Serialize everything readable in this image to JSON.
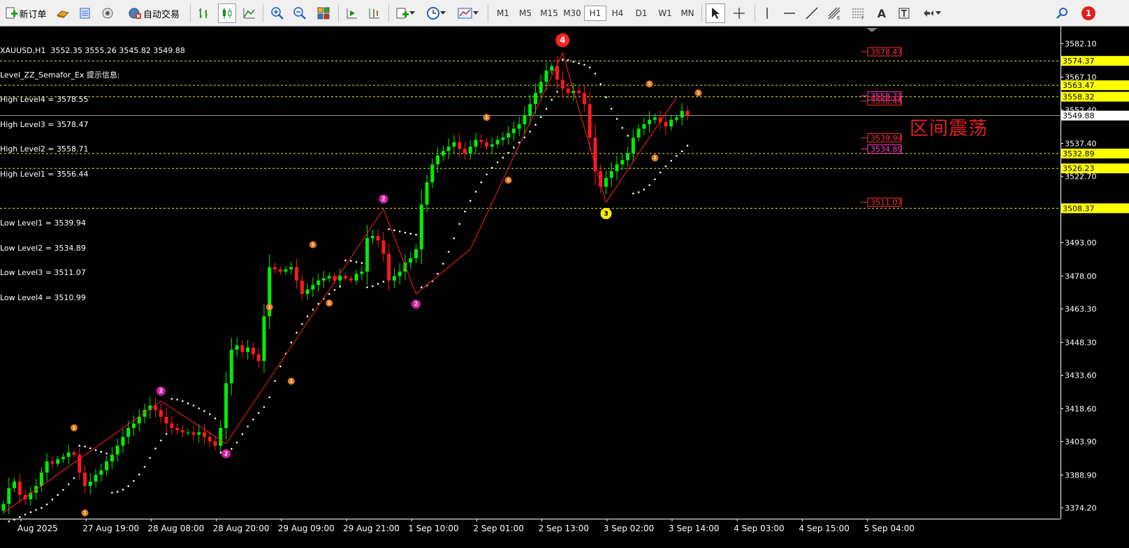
{
  "toolbar": {
    "new_order_label": "新订单",
    "auto_trade_label": "自动交易",
    "timeframes": [
      "M1",
      "M5",
      "M15",
      "M30",
      "H1",
      "H4",
      "D1",
      "W1",
      "MN"
    ],
    "active_timeframe": "H1",
    "text_tool_label": "A",
    "notification_count": "1"
  },
  "info_panel": {
    "header": "XAUUSD,H1  3552.35 3555.26 3545.82 3549.88",
    "indicator": "Level_ZZ_Semafor_Ex 提示信息:",
    "lines": [
      "High Level4 = 3578.55",
      "High Level3 = 3578.47",
      "High Level2 = 3558.71",
      "High Level1 = 3556.44",
      "",
      "Low Level1 = 3539.94",
      "Low Level2 = 3534.89",
      "Low Level3 = 3511.07",
      "Low Level4 = 3510.99"
    ]
  },
  "annotation": "区间震荡",
  "colors": {
    "bull": "#00ee00",
    "bear": "#ff1a1a",
    "zigzag": "#ff2020",
    "sar": "#ffffff",
    "level_line": "#e8e820",
    "label_bg": "#ffff00",
    "semafor1": "#e07a1a",
    "semafor2": "#d020a0",
    "semafor3": "#ffee00",
    "semafor4": "#ff2020",
    "accent_text": "#e02020"
  },
  "chart_data": {
    "type": "candlestick",
    "symbol": "XAUUSD",
    "timeframe": "H1",
    "ohlc_current": {
      "open": 3552.35,
      "high": 3555.26,
      "low": 3545.82,
      "close": 3549.88
    },
    "ylim": [
      3370.0,
      3590.0
    ],
    "yticks": [
      3582.1,
      3567.1,
      3552.4,
      3537.4,
      3522.7,
      3493.0,
      3478.0,
      3463.3,
      3448.3,
      3433.6,
      3418.6,
      3403.9,
      3388.9,
      3374.2
    ],
    "xticks": [
      "Aug 2025",
      "27 Aug 19:00",
      "28 Aug 08:00",
      "28 Aug 20:00",
      "29 Aug 09:00",
      "29 Aug 21:00",
      "1 Sep 10:00",
      "2 Sep 01:00",
      "2 Sep 13:00",
      "3 Sep 02:00",
      "3 Sep 14:00",
      "4 Sep 03:00",
      "4 Sep 15:00",
      "5 Sep 04:00"
    ],
    "bars_per_tick": 12,
    "current_price": 3549.88,
    "level_lines": [
      3574.37,
      3563.47,
      3558.32,
      3532.89,
      3526.23,
      3508.37
    ],
    "indicator_levels": [
      {
        "price": 3578.47,
        "label": "3578.47",
        "color": "#ff3030"
      },
      {
        "price": 3556.44,
        "label": "3556.44",
        "color": "#ff3030"
      },
      {
        "price": 3558.71,
        "label": "3558.71",
        "color": "#ff40c0"
      },
      {
        "price": 3539.94,
        "label": "3539.94",
        "color": "#ff3030"
      },
      {
        "price": 3534.89,
        "label": "3534.89",
        "color": "#ff40c0"
      },
      {
        "price": 3511.07,
        "label": "3511.07",
        "color": "#ff3030"
      }
    ],
    "closes": [
      3376,
      3383,
      3386,
      3380,
      3378,
      3381,
      3384,
      3390,
      3395,
      3394,
      3396,
      3397,
      3399,
      3398,
      3390,
      3384,
      3386,
      3389,
      3391,
      3395,
      3398,
      3402,
      3406,
      3410,
      3412,
      3415,
      3418,
      3420,
      3418,
      3415,
      3412,
      3410,
      3409,
      3408,
      3408,
      3407,
      3408,
      3406,
      3404,
      3402,
      3410,
      3430,
      3445,
      3447,
      3444,
      3446,
      3443,
      3440,
      3460,
      3482,
      3481,
      3480,
      3481,
      3482,
      3476,
      3470,
      3472,
      3474,
      3476,
      3477,
      3478,
      3476,
      3478,
      3477,
      3476,
      3479,
      3480,
      3495,
      3496,
      3494,
      3488,
      3476,
      3478,
      3480,
      3484,
      3486,
      3490,
      3510,
      3520,
      3528,
      3532,
      3534,
      3536,
      3538,
      3535,
      3533,
      3536,
      3539,
      3538,
      3536,
      3537,
      3539,
      3540,
      3542,
      3544,
      3546,
      3550,
      3555,
      3560,
      3565,
      3570,
      3572,
      3566,
      3562,
      3560,
      3561,
      3560,
      3555,
      3540,
      3525,
      3518,
      3522,
      3525,
      3528,
      3530,
      3533,
      3540,
      3544,
      3546,
      3548,
      3549,
      3547,
      3545,
      3548,
      3549,
      3552,
      3549.88
    ],
    "zigzag": [
      [
        0,
        3372
      ],
      [
        29,
        3422
      ],
      [
        41,
        3403
      ],
      [
        70,
        3508
      ],
      [
        76,
        3470
      ],
      [
        86,
        3490
      ],
      [
        103,
        3578
      ],
      [
        111,
        3511
      ],
      [
        117,
        3533
      ],
      [
        124,
        3558
      ]
    ],
    "semafors": [
      {
        "bar": 13,
        "price": 3406,
        "level": 1,
        "pos": "above"
      },
      {
        "bar": 15,
        "price": 3376,
        "level": 1,
        "pos": "below"
      },
      {
        "bar": 29,
        "price": 3422,
        "level": 2,
        "pos": "above"
      },
      {
        "bar": 41,
        "price": 3403,
        "level": 2,
        "pos": "below"
      },
      {
        "bar": 49,
        "price": 3460,
        "level": 1,
        "pos": "above"
      },
      {
        "bar": 53,
        "price": 3435,
        "level": 1,
        "pos": "below"
      },
      {
        "bar": 57,
        "price": 3488,
        "level": 1,
        "pos": "above"
      },
      {
        "bar": 60,
        "price": 3470,
        "level": 1,
        "pos": "below"
      },
      {
        "bar": 70,
        "price": 3508,
        "level": 2,
        "pos": "above"
      },
      {
        "bar": 76,
        "price": 3470,
        "level": 2,
        "pos": "below"
      },
      {
        "bar": 89,
        "price": 3545,
        "level": 1,
        "pos": "above"
      },
      {
        "bar": 93,
        "price": 3525,
        "level": 1,
        "pos": "below"
      },
      {
        "bar": 103,
        "price": 3578,
        "level": 4,
        "pos": "above"
      },
      {
        "bar": 111,
        "price": 3511,
        "level": 3,
        "pos": "below"
      },
      {
        "bar": 119,
        "price": 3560,
        "level": 1,
        "pos": "above"
      },
      {
        "bar": 120,
        "price": 3535,
        "level": 1,
        "pos": "below"
      },
      {
        "bar": 128,
        "price": 3556,
        "level": 1,
        "pos": "above"
      }
    ],
    "semafor_labels": [
      "1",
      "2",
      "3",
      "4"
    ]
  }
}
